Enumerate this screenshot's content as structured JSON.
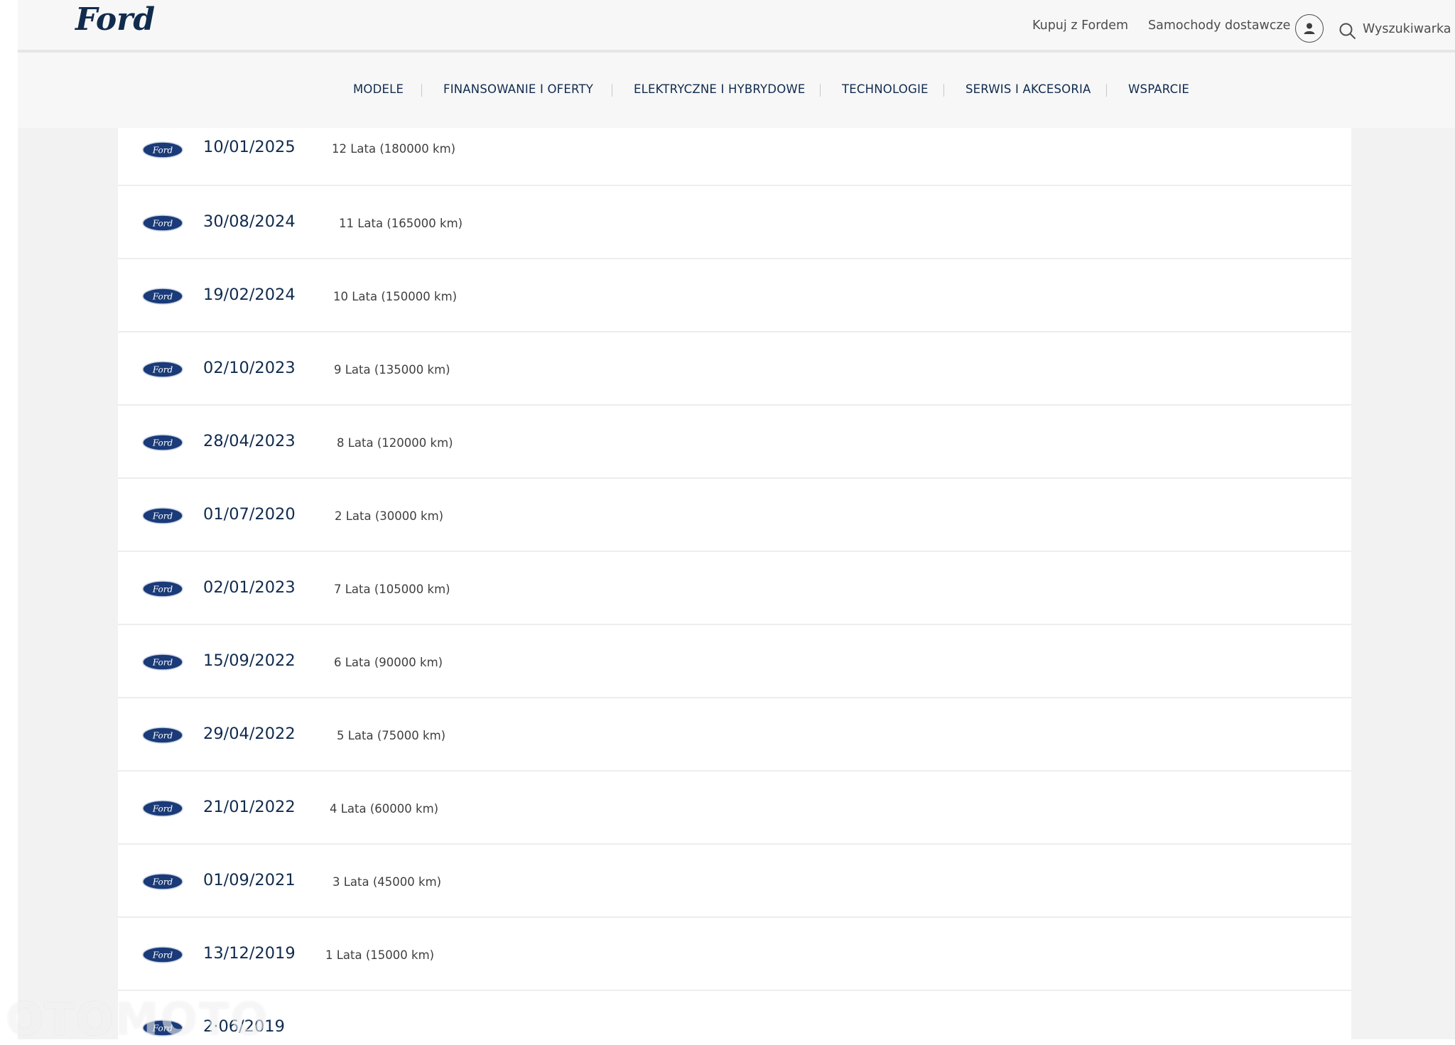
{
  "brand": {
    "logo_text": "Ford",
    "color_primary": "#102b4e",
    "color_logo_oval": "#1a3a78"
  },
  "header": {
    "utility_links": [
      "Kupuj z Fordem",
      "Samochody dostawcze"
    ],
    "account_icon": "person-icon",
    "search_icon": "magnifier-icon",
    "search_label": "Wyszukiwarka"
  },
  "nav": {
    "items": [
      "MODELE",
      "FINANSOWANIE I OFERTY",
      "ELEKTRYCZNE I HYBRYDOWE",
      "TECHNOLOGIE",
      "SERWIS I AKCESORIA",
      "WSPARCIE"
    ]
  },
  "service_history": {
    "rows": [
      {
        "date": "10/01/2025",
        "interval": "12 Lata (180000 km)"
      },
      {
        "date": "30/08/2024",
        "interval": "11 Lata (165000 km)"
      },
      {
        "date": "19/02/2024",
        "interval": "10 Lata (150000 km)"
      },
      {
        "date": "02/10/2023",
        "interval": "9 Lata (135000 km)"
      },
      {
        "date": "28/04/2023",
        "interval": "8 Lata (120000 km)"
      },
      {
        "date": "01/07/2020",
        "interval": "2 Lata (30000 km)"
      },
      {
        "date": "02/01/2023",
        "interval": "7 Lata (105000 km)"
      },
      {
        "date": "15/09/2022",
        "interval": "6 Lata (90000 km)"
      },
      {
        "date": "29/04/2022",
        "interval": "5 Lata (75000 km)"
      },
      {
        "date": "21/01/2022",
        "interval": "4 Lata (60000 km)"
      },
      {
        "date": "01/09/2021",
        "interval": "3 Lata (45000 km)"
      },
      {
        "date": "13/12/2019",
        "interval": "1 Lata (15000 km)"
      },
      {
        "date": "2·06/2019",
        "interval": ""
      }
    ]
  },
  "watermark": "OTOMOTO"
}
